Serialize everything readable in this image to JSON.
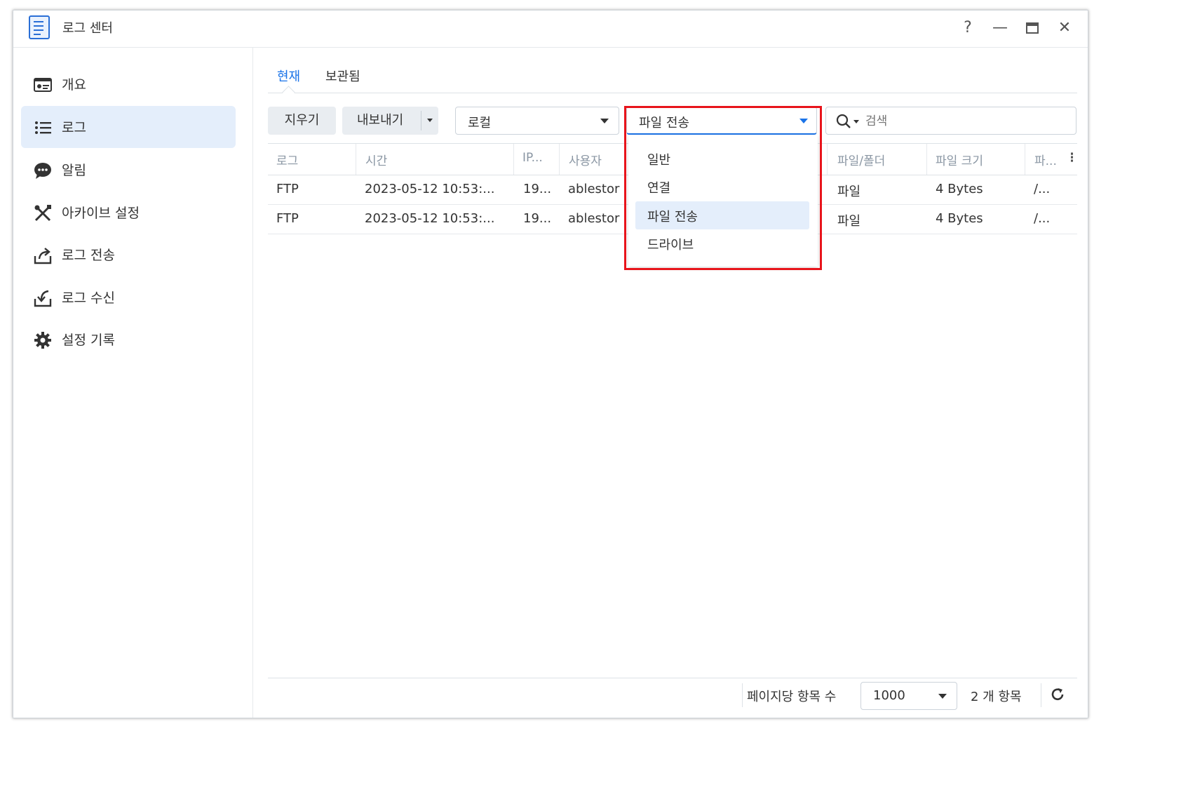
{
  "window": {
    "title": "로그 센터",
    "controls": {
      "help": "?",
      "minimize": "—",
      "maximize": "▭",
      "close": "✕"
    }
  },
  "sidebar": {
    "items": [
      {
        "label": "개요",
        "icon": "overview-icon"
      },
      {
        "label": "로그",
        "icon": "list-icon",
        "active": true
      },
      {
        "label": "알림",
        "icon": "chat-bubble-icon"
      },
      {
        "label": "아카이브 설정",
        "icon": "tools-icon"
      },
      {
        "label": "로그 전송",
        "icon": "upload-icon"
      },
      {
        "label": "로그 수신",
        "icon": "download-icon"
      },
      {
        "label": "설정 기록",
        "icon": "gear-icon"
      }
    ]
  },
  "tabs": [
    {
      "label": "현재",
      "active": true
    },
    {
      "label": "보관됨"
    }
  ],
  "toolbar": {
    "clear_label": "지우기",
    "export_label": "내보내기",
    "source_select": "로컬",
    "type_select": "파일 전송",
    "search_placeholder": "검색"
  },
  "dropdown": {
    "options": [
      "일반",
      "연결",
      "파일 전송",
      "드라이브"
    ],
    "selected": "파일 전송"
  },
  "table": {
    "headers": [
      "로그",
      "시간",
      "IP...",
      "사용자",
      "파일/폴더",
      "파일 크기",
      "파..."
    ],
    "rows": [
      [
        "FTP",
        "2023-05-12 10:53:...",
        "19...",
        "ablestor",
        "파일",
        "4 Bytes",
        "/..."
      ],
      [
        "FTP",
        "2023-05-12 10:53:...",
        "19...",
        "ablestor",
        "파일",
        "4 Bytes",
        "/..."
      ]
    ]
  },
  "footer": {
    "per_page_label": "페이지당 항목 수",
    "per_page_value": "1000",
    "count_label": "2 개 항목"
  },
  "colors": {
    "accent": "#1a73e8",
    "highlight_border": "#e8141b",
    "selected_bg": "#e4eefb"
  }
}
